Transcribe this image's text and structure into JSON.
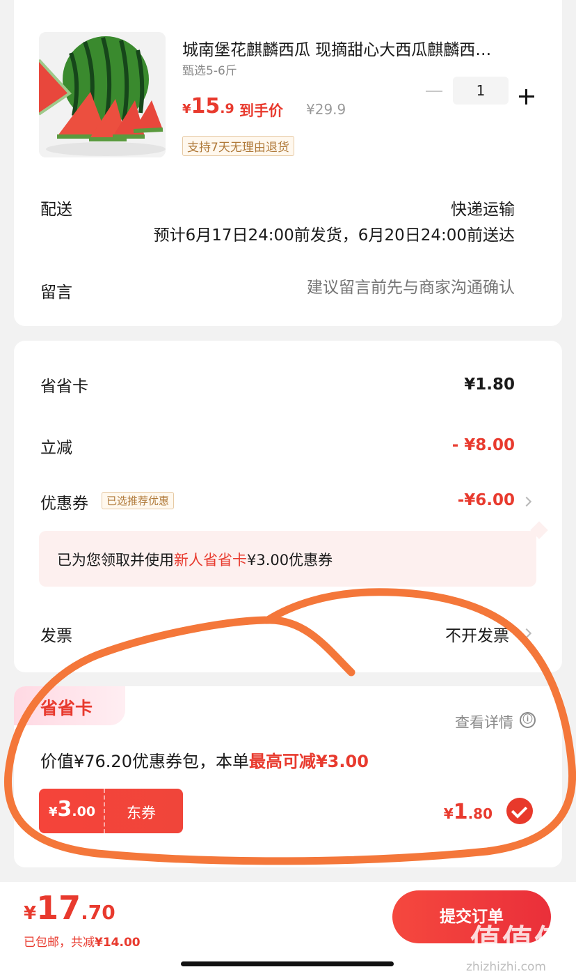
{
  "product": {
    "title": "城南堡花麒麟西瓜 现摘甜心大西瓜麒麟西…",
    "spec": "甄选5-6斤",
    "price_symbol": "¥",
    "price_integer": "15",
    "price_decimal": ".9",
    "price_tag": "到手价",
    "original_price": "¥29.9",
    "quantity": "1",
    "return_policy": "支持7天无理由退货",
    "image_icon": "watermelon-image"
  },
  "delivery": {
    "label": "配送",
    "method": "快递运输",
    "detail": "预计6月17日24:00前发货，6月20日24:00前送达"
  },
  "message": {
    "label": "留言",
    "placeholder": "建议留言前先与商家沟通确认"
  },
  "discounts": {
    "saver_card_label": "省省卡",
    "saver_card_value": "¥1.80",
    "instant_label": "立减",
    "instant_value": "- ¥8.00",
    "coupon_label": "优惠券",
    "coupon_tag": "已选推荐优惠",
    "coupon_value": "-¥6.00",
    "notice_prefix": "已为您领取并使用",
    "notice_highlight": "新人省省卡",
    "notice_suffix": "¥3.00优惠券",
    "invoice_label": "发票",
    "invoice_value": "不开发票"
  },
  "saver": {
    "tag": "省省卡",
    "detail_link": "查看详情",
    "info_icon": "ⓘ",
    "desc_prefix": "价值¥76.20优惠券包，本单",
    "desc_highlight": "最高可减¥3.00",
    "coupon_symbol": "¥",
    "coupon_integer": "3",
    "coupon_decimal": ".00",
    "coupon_name": "东券",
    "price_symbol": "¥",
    "price_integer": "1",
    "price_decimal": ".80"
  },
  "footer": {
    "total_symbol": "¥",
    "total_integer": "17",
    "total_decimal": ".70",
    "shipping_prefix": "已包邮，共减",
    "shipping_amount": "¥14.00",
    "submit": "提交订单",
    "watermark": "值值值",
    "watermark_url": "zhizhizhi.com"
  },
  "colors": {
    "accent": "#e83a2e",
    "annotation": "#f4773a"
  }
}
